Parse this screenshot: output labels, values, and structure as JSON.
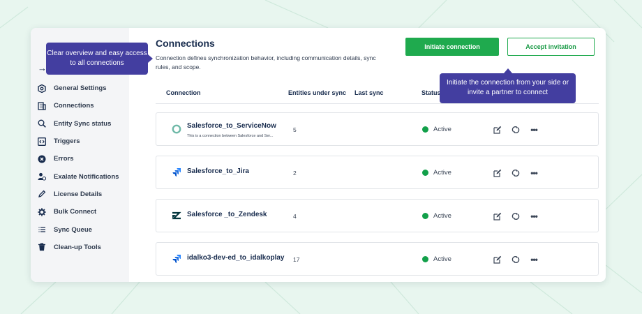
{
  "sidebar": {
    "items": [
      {
        "label": "General Settings",
        "icon": "shield-gear-icon"
      },
      {
        "label": "Connections",
        "icon": "building-icon"
      },
      {
        "label": "Entity Sync status",
        "icon": "search-icon"
      },
      {
        "label": "Triggers",
        "icon": "code-bracket-icon"
      },
      {
        "label": "Errors",
        "icon": "error-circle-icon"
      },
      {
        "label": "Exalate Notifications",
        "icon": "user-bell-icon"
      },
      {
        "label": "License Details",
        "icon": "pencil-icon"
      },
      {
        "label": "Bulk Connect",
        "icon": "gear-icon"
      },
      {
        "label": "Sync Queue",
        "icon": "list-icon"
      },
      {
        "label": "Clean-up Tools",
        "icon": "trash-icon"
      }
    ]
  },
  "main": {
    "title": "Connections",
    "description": "Connection defines synchronization behavior, including communication details, sync rules, and scope.",
    "buttons": {
      "initiate": "Initiate connection",
      "accept": "Accept invitation"
    },
    "columns": {
      "connection": "Connection",
      "entities": "Entities under sync",
      "last_sync": "Last sync",
      "status": "Status"
    },
    "rows": [
      {
        "name": "Salesforce_to_ServiceNow",
        "description": "This is a connection between Salesforce and Ser...",
        "entities": "5",
        "status": "Active",
        "icon": "servicenow-logo-icon"
      },
      {
        "name": "Salesforce_to_Jira",
        "description": "",
        "entities": "2",
        "status": "Active",
        "icon": "jira-logo-icon"
      },
      {
        "name": "Salesforce _to_Zendesk",
        "description": "",
        "entities": "4",
        "status": "Active",
        "icon": "zendesk-logo-icon"
      },
      {
        "name": "idalko3-dev-ed_to_idalkoplay",
        "description": "",
        "entities": "17",
        "status": "Active",
        "icon": "jira-logo-icon"
      }
    ],
    "more_glyph": "•••"
  },
  "tooltips": {
    "left": "Clear overview and easy access to all connections",
    "right": "Initiate the connection from your side or invite a partner to connect"
  },
  "colors": {
    "accent_green": "#1faa4e",
    "status_green": "#12a04a",
    "tooltip_purple": "#433ea0",
    "background": "#e8f6ef"
  }
}
